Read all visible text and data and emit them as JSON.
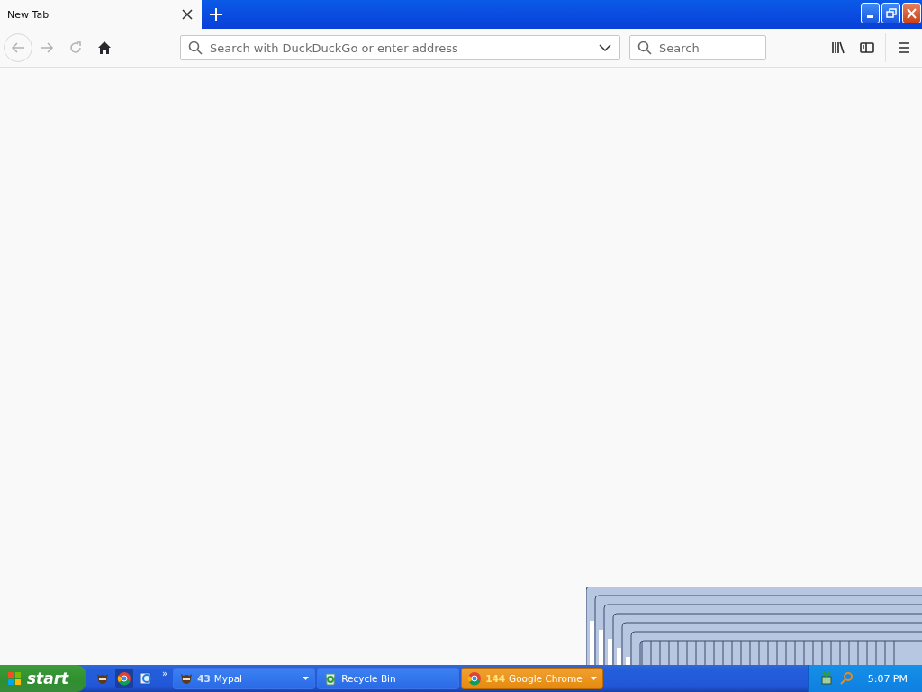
{
  "tabs": [
    {
      "label": "New Tab",
      "selected": true
    }
  ],
  "toolbar": {
    "address_placeholder": "Search with DuckDuckGo or enter address",
    "search_placeholder": "Search"
  },
  "taskbar": {
    "start": "start",
    "quick_launch_more": "»",
    "buttons": [
      {
        "count": "43",
        "label": "Mypal",
        "selected": false,
        "grouped": true,
        "kind": "mypal"
      },
      {
        "label": "Recycle Bin",
        "selected": false,
        "grouped": false,
        "kind": "recycle"
      },
      {
        "count": "144",
        "label": "Google Chrome",
        "selected": true,
        "grouped": true,
        "kind": "chrome"
      }
    ],
    "clock": "5:07 PM"
  }
}
